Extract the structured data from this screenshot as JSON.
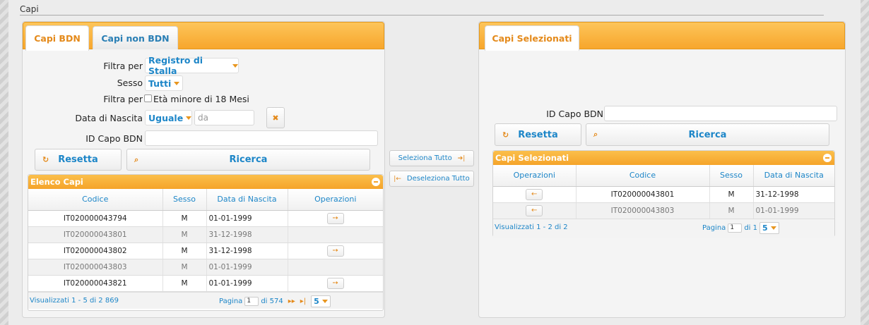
{
  "section": {
    "title": "Capi"
  },
  "left": {
    "tabs": [
      {
        "label": "Capi BDN"
      },
      {
        "label": "Capi non BDN"
      }
    ],
    "filters": {
      "filter_label": "Filtra per",
      "filter_value": "Registro di Stalla",
      "sex_label": "Sesso",
      "sex_value": "Tutti",
      "filter2_label": "Filtra per",
      "age_checkbox_label": "Età minore di 18 Mesi",
      "birth_label": "Data di Nascita",
      "birth_op": "Uguale",
      "birth_placeholder": "da",
      "id_label": "ID Capo BDN",
      "id_value": ""
    },
    "reset_label": "Resetta",
    "search_label": "Ricerca",
    "grid": {
      "title": "Elenco Capi",
      "columns": [
        "Codice",
        "Sesso",
        "Data di Nascita",
        "Operazioni"
      ],
      "rows": [
        {
          "codice": "IT020000043794",
          "sesso": "M",
          "data": "01-01-1999",
          "op": true
        },
        {
          "codice": "IT020000043801",
          "sesso": "M",
          "data": "31-12-1998",
          "op": false
        },
        {
          "codice": "IT020000043802",
          "sesso": "M",
          "data": "31-12-1998",
          "op": true
        },
        {
          "codice": "IT020000043803",
          "sesso": "M",
          "data": "01-01-1999",
          "op": false
        },
        {
          "codice": "IT020000043821",
          "sesso": "M",
          "data": "01-01-1999",
          "op": true
        }
      ],
      "footer_info": "Visualizzati 1 - 5 di 2 869",
      "page_label": "Pagina",
      "page_value": "1",
      "of_label": "di 574",
      "page_size": "5"
    }
  },
  "middle": {
    "select_all": "Seleziona Tutto",
    "deselect_all": "Deseleziona Tutto"
  },
  "right": {
    "tabs": [
      {
        "label": "Capi Selezionati"
      }
    ],
    "id_label": "ID Capo BDN",
    "id_value": "",
    "reset_label": "Resetta",
    "search_label": "Ricerca",
    "grid": {
      "title": "Capi Selezionati",
      "columns": [
        "Operazioni",
        "Codice",
        "Sesso",
        "Data di Nascita"
      ],
      "rows": [
        {
          "codice": "IT020000043801",
          "sesso": "M",
          "data": "31-12-1998"
        },
        {
          "codice": "IT020000043803",
          "sesso": "M",
          "data": "01-01-1999"
        }
      ],
      "footer_info": "Visualizzati 1 - 2 di 2",
      "page_label": "Pagina",
      "page_value": "1",
      "of_label": "di 1",
      "page_size": "5"
    }
  },
  "colors": {
    "accent": "#f7a62c",
    "link": "#1d86c8",
    "active_tab_text": "#e48a1b"
  }
}
